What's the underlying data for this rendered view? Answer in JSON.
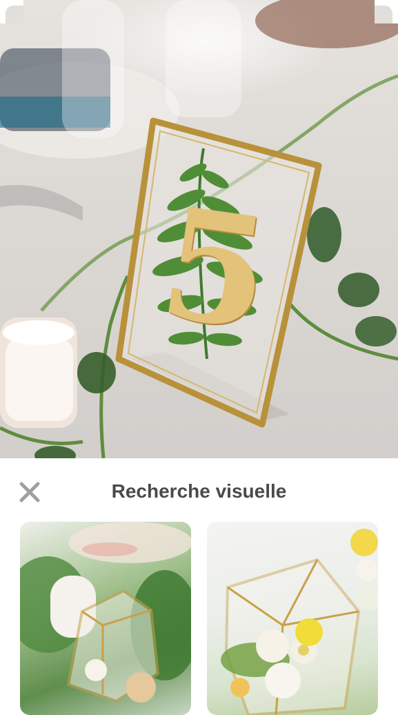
{
  "visual_search": {
    "title": "Recherche visuelle",
    "close_icon": "close-icon"
  },
  "hero": {
    "table_number": "5"
  },
  "results": [
    {
      "icon": "terrarium-image"
    },
    {
      "icon": "terrarium-image"
    }
  ],
  "colors": {
    "title_text": "#4a4a4a",
    "close_icon": "#a0a0a0",
    "brass": "#b8913a"
  }
}
